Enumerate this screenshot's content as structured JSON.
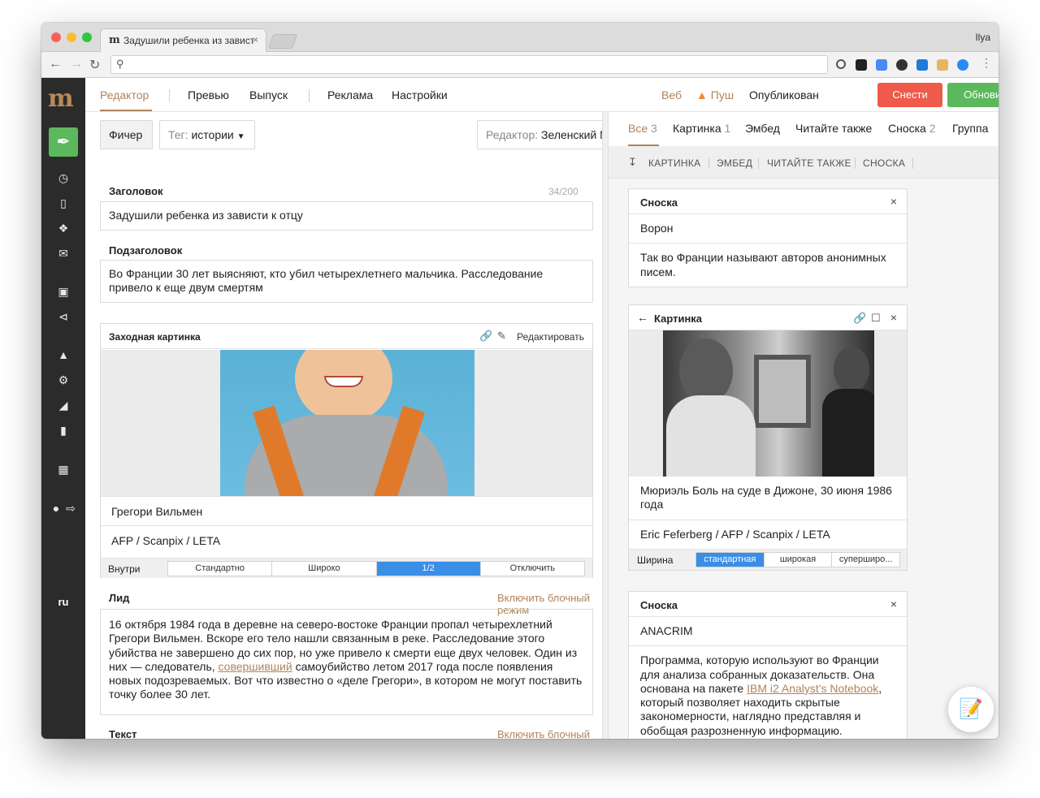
{
  "browser": {
    "tab_title": "Задушили ребенка из зависти к отцу",
    "tab_close": "×",
    "user": "Ilya",
    "favicon": "m"
  },
  "sidebar": {
    "logo": "m",
    "language": "ru",
    "icons": [
      "feather-icon",
      "clock-icon",
      "document-icon",
      "tags-icon",
      "mail-icon",
      "monitor-icon",
      "share-icon",
      "megaphone-icon",
      "gear-icon",
      "chart-icon",
      "book-icon",
      "calculator-icon",
      "user-icon",
      "logout-icon"
    ]
  },
  "header": {
    "nav": [
      "Редактор",
      "Превью",
      "Выпуск",
      "Реклама",
      "Настройки"
    ],
    "web": "Веб",
    "push": "Пуш",
    "status": "Опубликован",
    "delete_button": "Снести",
    "update_button": "Обновить",
    "colors": {
      "accent": "#b0835a",
      "danger": "#ef5a4a",
      "success": "#5cb85c",
      "selected": "#3a8ee6"
    }
  },
  "editor": {
    "type_chip": "Фичер",
    "tag_label": "Тег:",
    "tag_value": "истории",
    "editor_label": "Редактор:",
    "editor_value": "Зеленский М.",
    "title_label": "Заголовок",
    "title_count": "34/200",
    "title_value": "Задушили ребенка из зависти к отцу",
    "subtitle_label": "Подзаголовок",
    "subtitle_value": "Во Франции 30 лет выясняют, кто убил четырехлетнего мальчика. Расследование привело к еще двум смертям",
    "image_block": {
      "title": "Заходная картинка",
      "edit": "Редактировать",
      "caption": "Грегори Вильмен",
      "credit": "AFP / Scanpix / LETA",
      "inside_label": "Внутри",
      "options": [
        "Стандартно",
        "Широко",
        "1/2",
        "Отключить"
      ],
      "selected": "1/2"
    },
    "lead_label": "Лид",
    "block_mode": "Включить блочный режим",
    "lead_before": "16 октября 1984 года в деревне на северо-востоке Франции пропал четырехлетний Грегори Вильмен. Вскоре его тело нашли связанным в реке. Расследование этого убийства не завершено до сих пор, но уже привело к смерти еще двух человек. Один из них — следователь, ",
    "lead_link": "совершивший",
    "lead_after": " самоубийство летом 2017 года после появления новых подозреваемых. Вот что известно о «деле Грегори», в котором не могут поставить точку более 30 лет.",
    "text_label": "Текст",
    "text_block_mode": "Включить блочный режим"
  },
  "panel": {
    "tabs": [
      {
        "label": "Все",
        "count": "3"
      },
      {
        "label": "Картинка",
        "count": "1"
      },
      {
        "label": "Эмбед",
        "count": ""
      },
      {
        "label": "Читайте также",
        "count": ""
      },
      {
        "label": "Сноска",
        "count": "2"
      },
      {
        "label": "Группа",
        "count": ""
      }
    ],
    "tools": [
      "КАРТИНКА",
      "ЭМБЕД",
      "ЧИТАЙТЕ ТАКЖЕ",
      "СНОСКА"
    ],
    "card1": {
      "title": "Сноска",
      "term": "Ворон",
      "desc": "Так во Франции называют авторов анонимных писем."
    },
    "card2": {
      "title": "Картинка",
      "back": "←",
      "caption": "Мюриэль Боль на суде в Дижоне, 30 июня 1986 года",
      "credit": "Eric Feferberg / AFP / Scanpix / LETA",
      "width_label": "Ширина",
      "options": [
        "стандартная",
        "широкая",
        "супершироки"
      ],
      "options_display": [
        "стандартная",
        "широкая",
        "суперширо..."
      ],
      "selected": "стандартная"
    },
    "card3": {
      "title": "Сноска",
      "term": "ANACRIM",
      "desc_before": "Программа, которую используют во Франции для анализа собранных доказательств. Она основана на пакете ",
      "desc_link": "IBM i2 Analyst's Notebook",
      "desc_after": ", который позволяет находить скрытые закономерности, наглядно представляя и обобщая разрозненную информацию."
    },
    "close": "×"
  }
}
